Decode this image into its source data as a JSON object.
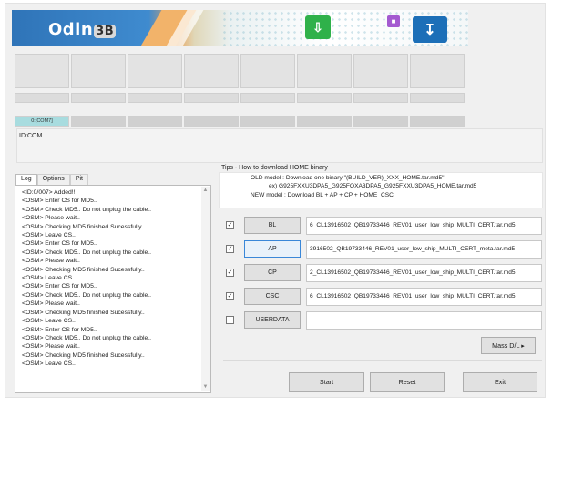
{
  "banner": {
    "logo_text": "Odin",
    "logo_version": "3B",
    "icons": [
      "install-icon",
      "gift-icon",
      "download-icon"
    ]
  },
  "ports": {
    "active_port_label": "0:[COM7]",
    "id_com_label": "ID:COM"
  },
  "log": {
    "tabs": [
      "Log",
      "Options",
      "Pit"
    ],
    "active_tab": "Log",
    "lines": [
      "<ID:0/007> Added!!",
      "<OSM> Enter CS for MD5..",
      "<OSM> Check MD5.. Do not unplug the cable..",
      "<OSM> Please wait..",
      "<OSM> Checking MD5 finished Sucessfully..",
      "<OSM> Leave CS..",
      "<OSM> Enter CS for MD5..",
      "<OSM> Check MD5.. Do not unplug the cable..",
      "<OSM> Please wait..",
      "<OSM> Checking MD5 finished Sucessfully..",
      "<OSM> Leave CS..",
      "<OSM> Enter CS for MD5..",
      "<OSM> Check MD5.. Do not unplug the cable..",
      "<OSM> Please wait..",
      "<OSM> Checking MD5 finished Sucessfully..",
      "<OSM> Leave CS..",
      "<OSM> Enter CS for MD5..",
      "<OSM> Check MD5.. Do not unplug the cable..",
      "<OSM> Please wait..",
      "<OSM> Checking MD5 finished Sucessfully..",
      "<OSM> Leave CS.."
    ]
  },
  "tips": {
    "title": "Tips - How to download HOME binary",
    "old_model": "OLD model  : Download one binary    \"(BUILD_VER)_XXX_HOME.tar.md5\"",
    "example": "ex) G925FXXU3DPA5_G925FOXA3DPA5_G925FXXU3DPA5_HOME.tar.md5",
    "new_model": "NEW model : Download BL + AP + CP + HOME_CSC"
  },
  "files": [
    {
      "label": "BL",
      "checked": true,
      "path": "6_CL13916502_QB19733446_REV01_user_low_ship_MULTI_CERT.tar.md5"
    },
    {
      "label": "AP",
      "checked": true,
      "path": "3916502_QB19733446_REV01_user_low_ship_MULTI_CERT_meta.tar.md5"
    },
    {
      "label": "CP",
      "checked": true,
      "path": "2_CL13916502_QB19733446_REV01_user_low_ship_MULTI_CERT.tar.md5"
    },
    {
      "label": "CSC",
      "checked": true,
      "path": "6_CL13916502_QB19733446_REV01_user_low_ship_MULTI_CERT.tar.md5"
    },
    {
      "label": "USERDATA",
      "checked": false,
      "path": ""
    }
  ],
  "buttons": {
    "mass_dl": "Mass D/L ▸",
    "start": "Start",
    "reset": "Reset",
    "exit": "Exit"
  },
  "check_mark": "✓"
}
